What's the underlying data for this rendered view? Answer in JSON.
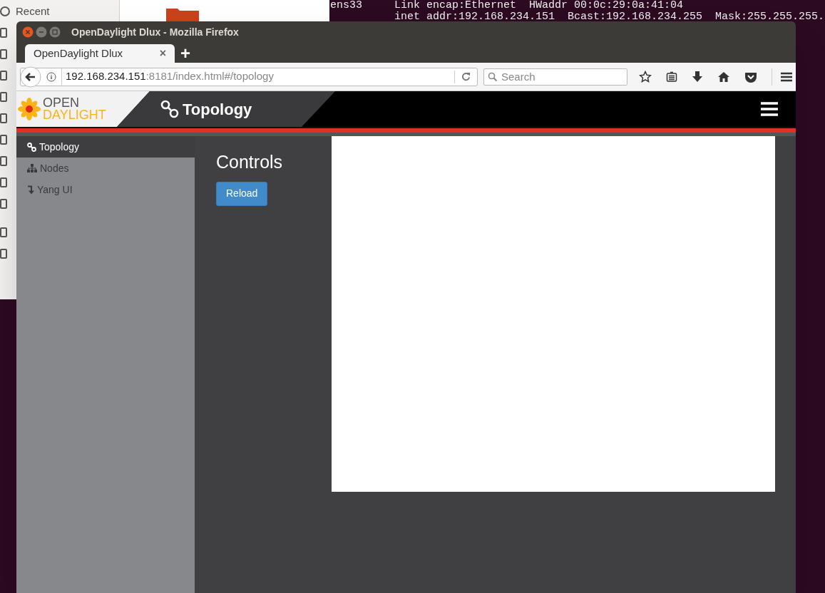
{
  "desktop": {
    "file_manager": {
      "places": [
        {
          "label": "Recent"
        }
      ]
    },
    "terminal": {
      "lines": [
        "ens33     Link encap:Ethernet  HWaddr 00:0c:29:0a:41:04",
        "          inet addr:192.168.234.151  Bcast:192.168.234.255  Mask:255.255.255."
      ]
    }
  },
  "browser": {
    "window_title": "OpenDaylight Dlux - Mozilla Firefox",
    "tabs": [
      {
        "label": "OpenDaylight Dlux",
        "close": "×",
        "selected": true
      }
    ],
    "new_tab": "+",
    "url": {
      "host": "192.168.234.151",
      "rest": ":8181/index.html#/topology"
    },
    "search": {
      "placeholder": "Search"
    }
  },
  "app": {
    "logo": {
      "line1": "OPEN",
      "line2": "DAYLIGHT"
    },
    "page_title": "Topology",
    "nav": [
      {
        "label": "Topology",
        "kind": "link",
        "selected": true
      },
      {
        "label": "Nodes",
        "kind": "sitemap",
        "selected": false
      },
      {
        "label": "Yang UI",
        "kind": "arrow",
        "selected": false
      }
    ],
    "controls": {
      "heading": "Controls",
      "button": "Reload"
    }
  }
}
